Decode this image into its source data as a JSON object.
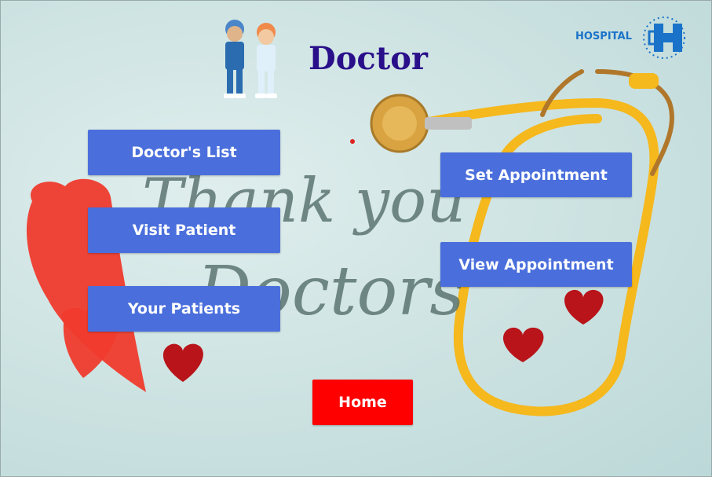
{
  "page": {
    "title": "Doctor"
  },
  "logo": {
    "text": "HOSPITAL"
  },
  "background": {
    "line1": "Thank you",
    "line2": "Doctors"
  },
  "buttons": {
    "doctors_list": "Doctor's List",
    "visit_patient": "Visit Patient",
    "your_patients": "Your Patients",
    "set_appointment": "Set Appointment",
    "view_appointment": "View Appointment",
    "home": "Home"
  },
  "colors": {
    "button_blue": "#4a6fdc",
    "home_red": "#fe0000",
    "title": "#2a0f8a",
    "logo_blue": "#1a73c9"
  }
}
